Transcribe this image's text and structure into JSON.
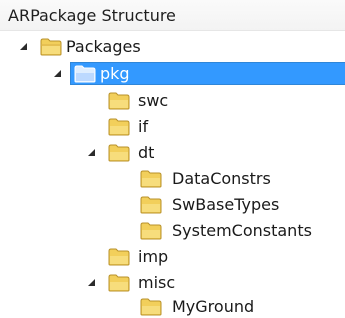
{
  "panel": {
    "title": "ARPackage Structure"
  },
  "tree": {
    "packages": {
      "label": "Packages",
      "expanded": true
    },
    "pkg": {
      "label": "pkg",
      "expanded": true,
      "selected": true
    },
    "swc": {
      "label": "swc"
    },
    "if": {
      "label": "if"
    },
    "dt": {
      "label": "dt",
      "expanded": true
    },
    "data_constrs": {
      "label": "DataConstrs"
    },
    "sw_base_types": {
      "label": "SwBaseTypes"
    },
    "system_constants": {
      "label": "SystemConstants"
    },
    "imp": {
      "label": "imp"
    },
    "misc": {
      "label": "misc",
      "expanded": true
    },
    "my_ground": {
      "label": "MyGround"
    }
  },
  "colors": {
    "selection": "#3399ff",
    "folder": "#f2cf5b",
    "folder_selected": "#ffffff"
  },
  "icons": {
    "expand": "expanded-arrow-icon",
    "folder": "folder-icon"
  }
}
